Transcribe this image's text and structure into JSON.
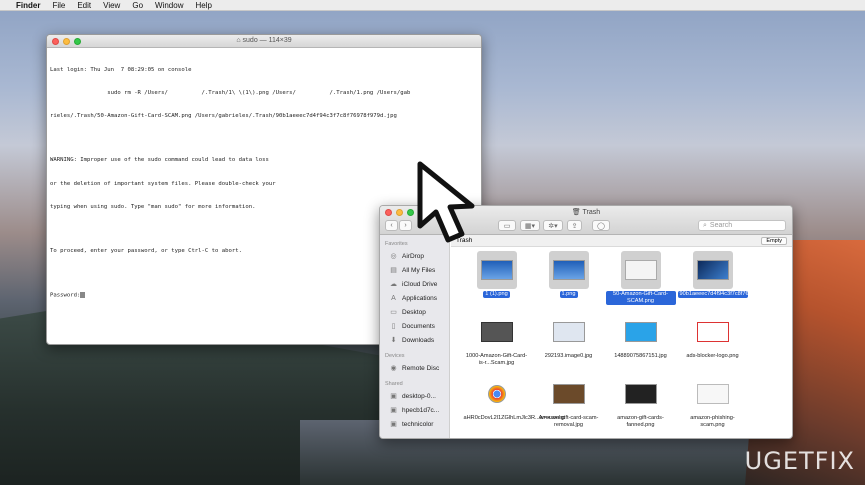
{
  "menubar": {
    "apple": "",
    "app": "Finder",
    "items": [
      "File",
      "Edit",
      "View",
      "Go",
      "Window",
      "Help"
    ]
  },
  "terminal": {
    "title": "sudo — 114×39",
    "lines": [
      "Last login: Thu Jun  7 08:29:05 on console",
      "                 sudo rm -R /Users/          /.Trash/1\\ \\(1\\).png /Users/          /.Trash/1.png /Users/gab",
      "rieles/.Trash/50-Amazon-Gift-Card-SCAM.png /Users/gabrieles/.Trash/90b1aeeec7d4f94c3f7c8f76978f979d.jpg",
      "",
      "WARNING: Improper use of the sudo command could lead to data loss",
      "or the deletion of important system files. Please double-check your",
      "typing when using sudo. Type \"man sudo\" for more information.",
      "",
      "To proceed, enter your password, or type Ctrl-C to abort.",
      "",
      "Password:"
    ]
  },
  "finder": {
    "title": "Trash",
    "search_placeholder": "Search",
    "path_label": "Trash",
    "empty_label": "Empty",
    "sidebar": {
      "favorites_label": "Favorites",
      "favorites": [
        "AirDrop",
        "All My Files",
        "iCloud Drive",
        "Applications",
        "Desktop",
        "Documents",
        "Downloads"
      ],
      "devices_label": "Devices",
      "devices": [
        "Remote Disc"
      ],
      "shared_label": "Shared",
      "shared": [
        "desktop-0...",
        "hpecb1d7c...",
        "technicolor"
      ]
    },
    "files": [
      {
        "name": "1 (1).png",
        "selected": true,
        "thumb": "blue"
      },
      {
        "name": "1.png",
        "selected": true,
        "thumb": "blue"
      },
      {
        "name": "50-Amazon-Gift-Card-SCAM.png",
        "selected": true,
        "thumb": "doc"
      },
      {
        "name": "90b1aeeec7d4f94c3f7c8f76...f979d.jpg",
        "selected": true,
        "thumb": "dark"
      },
      {
        "name": "1000-Amazon-Gift-Card-is-r...Scam.jpg",
        "selected": false,
        "thumb": "screen"
      },
      {
        "name": "292193.image0.jpg",
        "selected": false,
        "thumb": "light"
      },
      {
        "name": "14889075867151.jpg",
        "selected": false,
        "thumb": "twitter"
      },
      {
        "name": "ads-blocker-logo.png",
        "selected": false,
        "thumb": "logo"
      },
      {
        "name": "aHR0cDovL2l1ZGlhLmJlc3R...w==.webp",
        "selected": false,
        "thumb": "chrome"
      },
      {
        "name": "Amazon-gift-card-scam-removal.jpg",
        "selected": false,
        "thumb": "gift"
      },
      {
        "name": "amazon-gift-cards-fanned.png",
        "selected": false,
        "thumb": "cards"
      },
      {
        "name": "amazon-phishing-scam.png",
        "selected": false,
        "thumb": "doc2"
      }
    ]
  },
  "watermark": {
    "left": "UG",
    "e": "E",
    "right": "TFIX"
  },
  "colors": {
    "selection": "#2b66d9",
    "close": "#fc605c",
    "minimize": "#fdbc40",
    "zoom": "#34c84a"
  }
}
